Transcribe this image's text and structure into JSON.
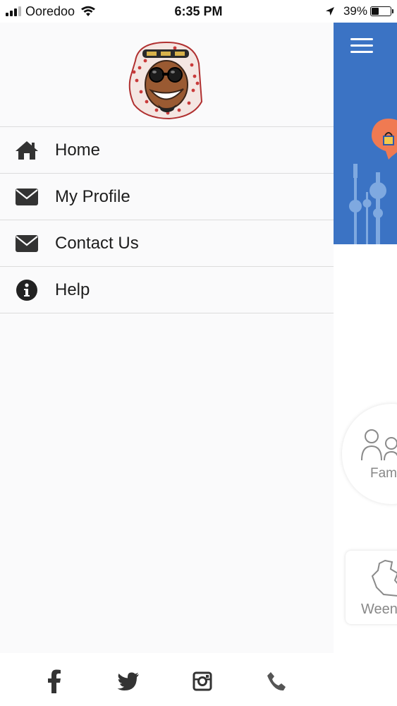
{
  "status_bar": {
    "carrier": "Ooredoo",
    "time": "6:35 PM",
    "battery": "39%",
    "battery_level": 0.39
  },
  "drawer": {
    "menu_items": [
      {
        "label": "Home",
        "icon": "home-icon"
      },
      {
        "label": "My Profile",
        "icon": "envelope-icon"
      },
      {
        "label": "Contact Us",
        "icon": "envelope-icon"
      },
      {
        "label": "Help",
        "icon": "info-circle-icon"
      }
    ]
  },
  "main_screen": {
    "header_color": "#3b73c4",
    "family_card_label": "Fam",
    "ween_card_label": "Ween"
  },
  "social_links": [
    "facebook-icon",
    "twitter-icon",
    "instagram-icon",
    "phone-icon"
  ]
}
